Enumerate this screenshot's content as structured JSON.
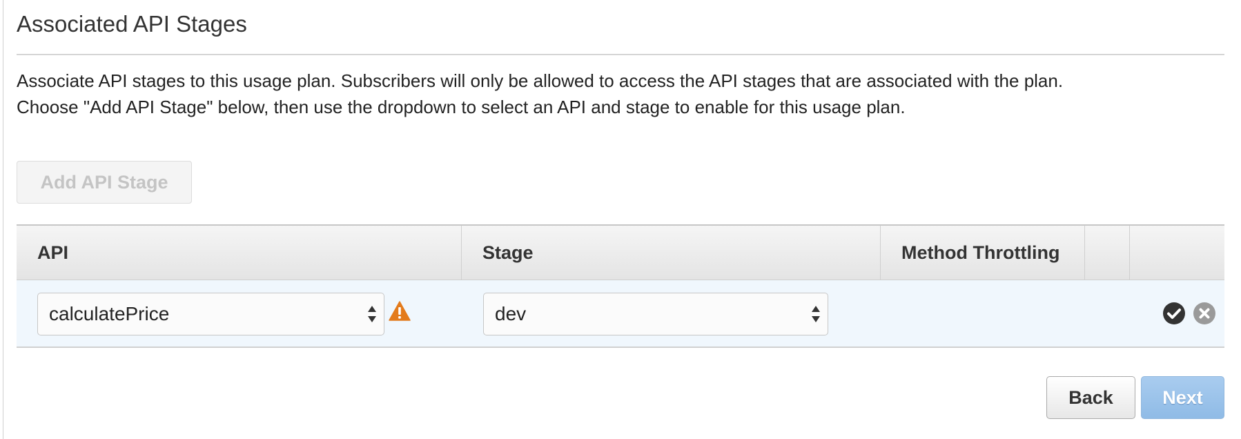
{
  "section": {
    "title": "Associated API Stages",
    "description_line1": "Associate API stages to this usage plan. Subscribers will only be allowed to access the API stages that are associated with the plan.",
    "description_line2": "Choose \"Add API Stage\" below, then use the dropdown to select an API and stage to enable for this usage plan."
  },
  "toolbar": {
    "add_stage_label": "Add API Stage",
    "add_stage_disabled": true
  },
  "table": {
    "columns": {
      "api": "API",
      "stage": "Stage",
      "method_throttling": "Method Throttling"
    },
    "rows": [
      {
        "api": "calculatePrice",
        "stage": "dev",
        "api_warning": true
      }
    ]
  },
  "icons": {
    "warning": "warning-icon",
    "confirm": "check-circle-icon",
    "remove": "close-circle-icon"
  },
  "footer": {
    "back_label": "Back",
    "next_label": "Next"
  },
  "colors": {
    "warning": "#e37b1c",
    "confirm": "#333333",
    "remove": "#9a9a9a",
    "next_button": "#9cc3ea",
    "row_highlight": "#f0f7fd"
  }
}
